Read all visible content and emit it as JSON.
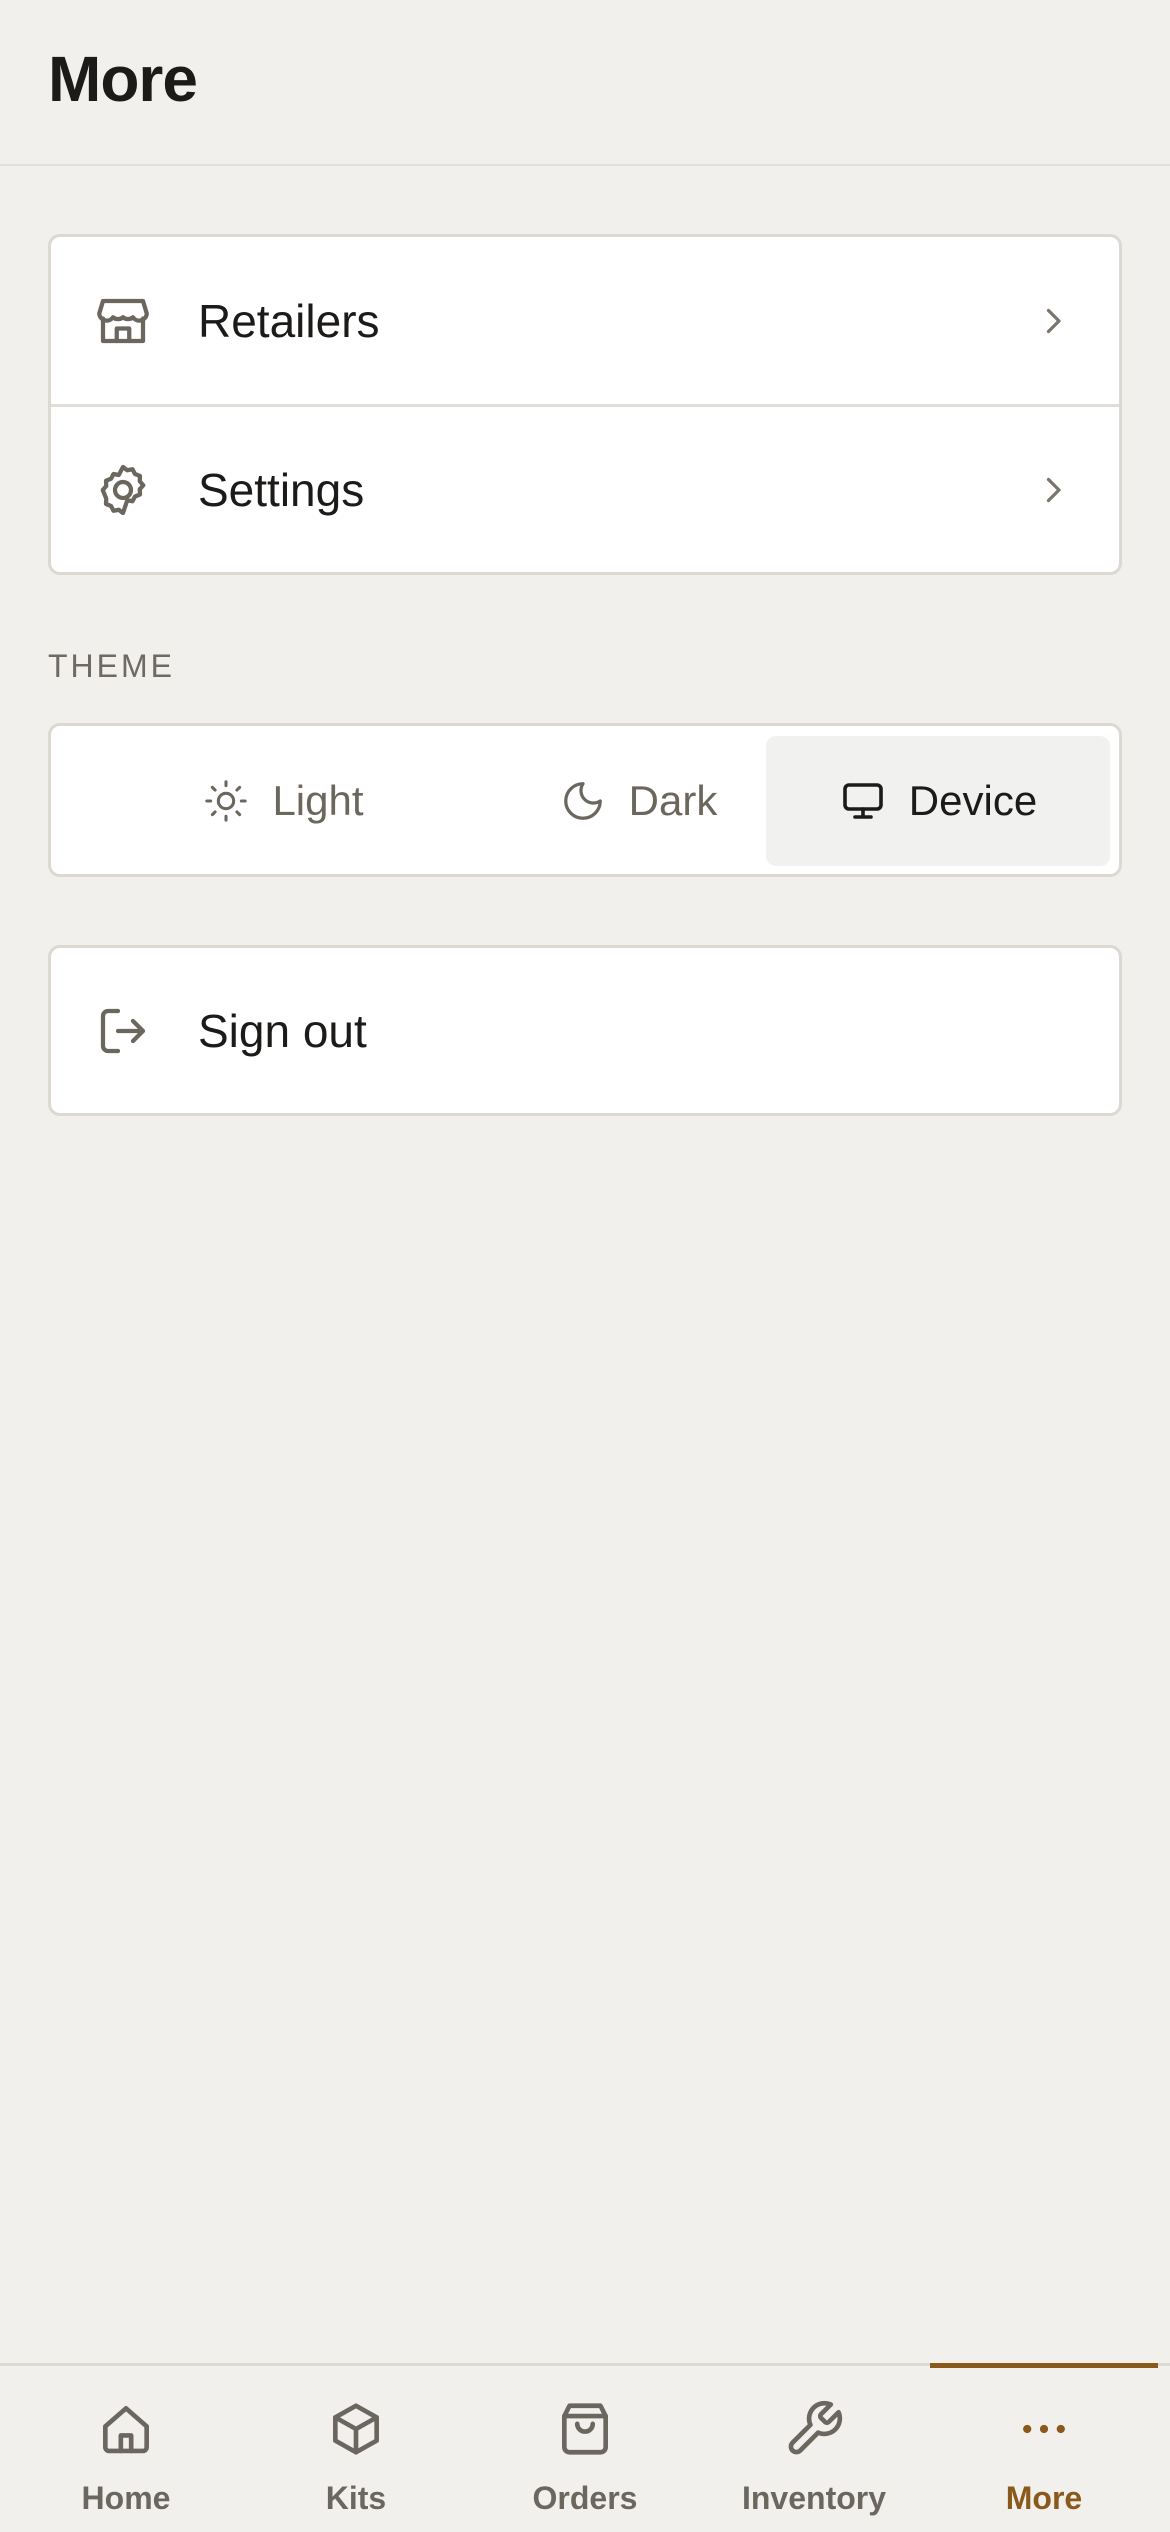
{
  "header": {
    "title": "More"
  },
  "menu": {
    "items": [
      {
        "label": "Retailers",
        "icon": "store-icon"
      },
      {
        "label": "Settings",
        "icon": "gear-icon"
      }
    ]
  },
  "theme": {
    "section_label": "THEME",
    "options": [
      {
        "label": "Light",
        "icon": "sun-icon",
        "selected": false
      },
      {
        "label": "Dark",
        "icon": "moon-icon",
        "selected": false
      },
      {
        "label": "Device",
        "icon": "monitor-icon",
        "selected": true
      }
    ]
  },
  "signout": {
    "label": "Sign out",
    "icon": "sign-out-icon"
  },
  "tabbar": {
    "active": "More",
    "accent_color": "#8a5a1c",
    "tabs": [
      {
        "label": "Home",
        "icon": "home-icon"
      },
      {
        "label": "Kits",
        "icon": "box-icon"
      },
      {
        "label": "Orders",
        "icon": "shopping-bag-icon"
      },
      {
        "label": "Inventory",
        "icon": "wrench-icon"
      },
      {
        "label": "More",
        "icon": "more-dots-icon"
      }
    ]
  }
}
